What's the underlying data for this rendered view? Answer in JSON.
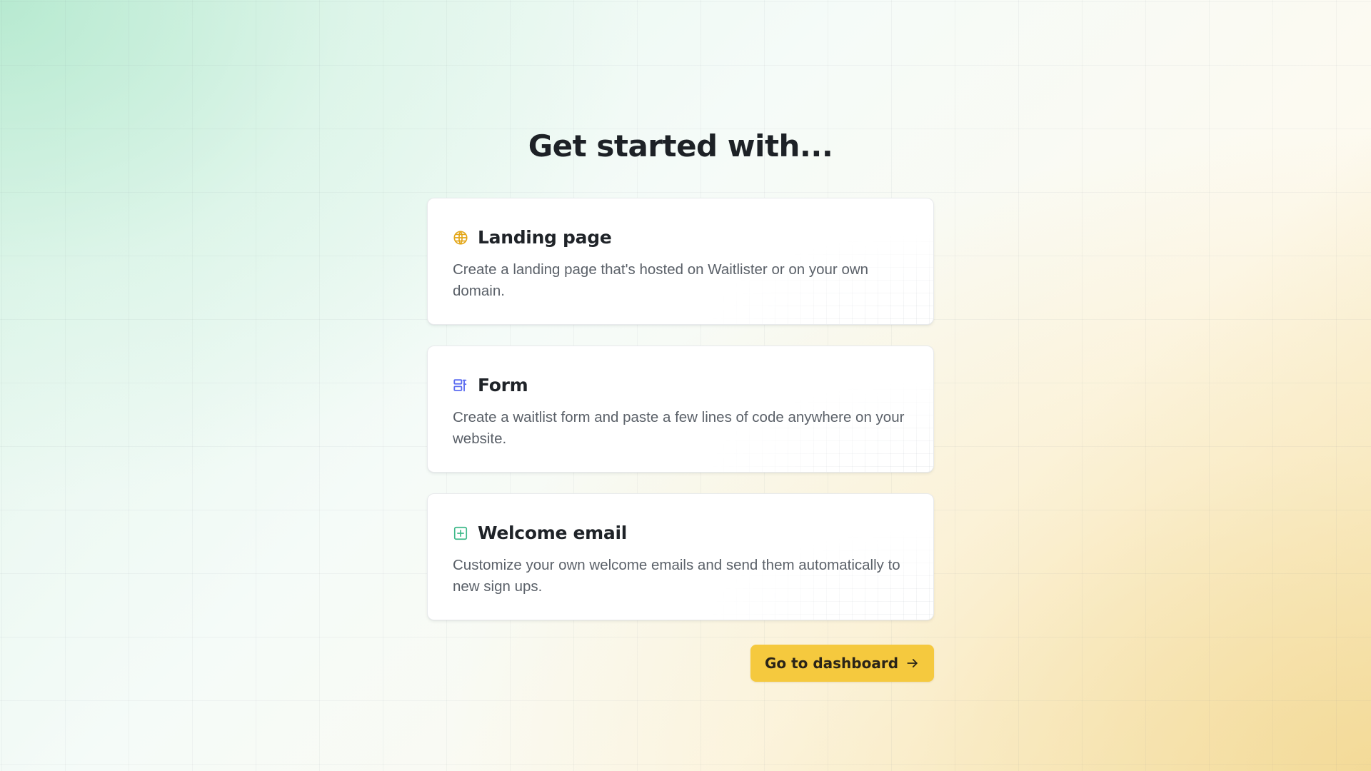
{
  "page": {
    "heading": "Get started with..."
  },
  "cards": [
    {
      "icon": "globe-icon",
      "title": "Landing page",
      "description": "Create a landing page that's hosted on Waitlister or on your own domain.",
      "icon_color": "#e3a617"
    },
    {
      "icon": "form-icon",
      "title": "Form",
      "description": "Create a waitlist form and paste a few lines of code anywhere on your website.",
      "icon_color": "#5b6cf0"
    },
    {
      "icon": "plus-square-icon",
      "title": "Welcome email",
      "description": "Customize your own welcome emails and send them automatically to new sign ups.",
      "icon_color": "#3fb98a"
    }
  ],
  "cta": {
    "label": "Go to dashboard",
    "icon": "arrow-right-icon",
    "color": "#f5c93e"
  },
  "theme": {
    "text": "#1f2328",
    "muted_text": "#5b6169",
    "background_green": "#dff5ea",
    "background_yellow": "#f7e7bb"
  }
}
